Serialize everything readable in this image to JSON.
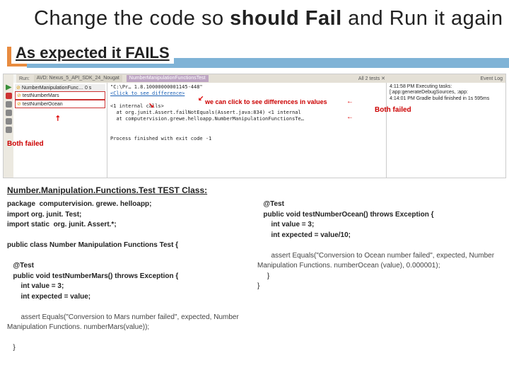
{
  "title_pre": "Change the code so ",
  "title_bold1": "should Fail",
  "title_mid": " and Run it again",
  "fail_banner": "As expected it FAILS",
  "ide": {
    "run_label": "Run:",
    "tab1": "AVD: Nexus_5_API_SDK_24_Nougat",
    "tab2": "NumberManipulationFunctionsTest",
    "event_log": "Event Log",
    "tree_header": "NumberManipulationFunc… 0 s",
    "tree_item1": "testNumberMars",
    "tree_item2": "testNumberOcean",
    "main_header": "\"C:\\Pr… 1.8.10000000001145-448\"",
    "main_sub": "<Click to see difference>",
    "main_line1": "<1 internal calls>",
    "main_line2": "at org.junit.Assert.failNotEquals(Assert.java:834) <1 internal",
    "main_line3": "at computervision.grewe.helloapp.NumberManipulationFunctionsTe…",
    "main_done": "Process finished with exit code -1",
    "right_l1": "4:11:58 PM Executing tasks: [:app:generateDebugSources, :app:",
    "right_l2": "4:14:01 PM Gradle build finished in 1s 595ms",
    "tests_label": "All 2 tests ✕"
  },
  "callout_diff": "we can click to see\ndifferences in values",
  "both_failed": "Both failed",
  "class_title": "Number.Manipulation.Functions.Test TEST Class:",
  "code_left_1": "package  computervision. grewe. helloapp;",
  "code_left_2": "import org. junit. Test;",
  "code_left_3": "import static  org. junit. Assert.*;",
  "code_left_4": "public class Number Manipulation Functions Test {",
  "code_left_5": "   @Test",
  "code_left_6": "   public void testNumberMars() throws Exception {",
  "code_left_7": "       int value = 3;",
  "code_left_8": "       int expected = value;",
  "code_left_9": "       assert Equals(\"Conversion to Mars number failed\", expected, Number Manipulation Functions. numberMars(value));",
  "code_left_10": "   }",
  "code_r_1": "   @Test",
  "code_r_2": "   public void testNumberOcean() throws Exception {",
  "code_r_3": "       int value = 3;",
  "code_r_4": "       int expected = value/10;",
  "code_r_5": "       assert Equals(\"Conversion to Ocean number failed\", expected, Number Manipulation Functions. numberOcean (value), 0.000001);",
  "code_r_6": "     }",
  "code_r_7": "}"
}
